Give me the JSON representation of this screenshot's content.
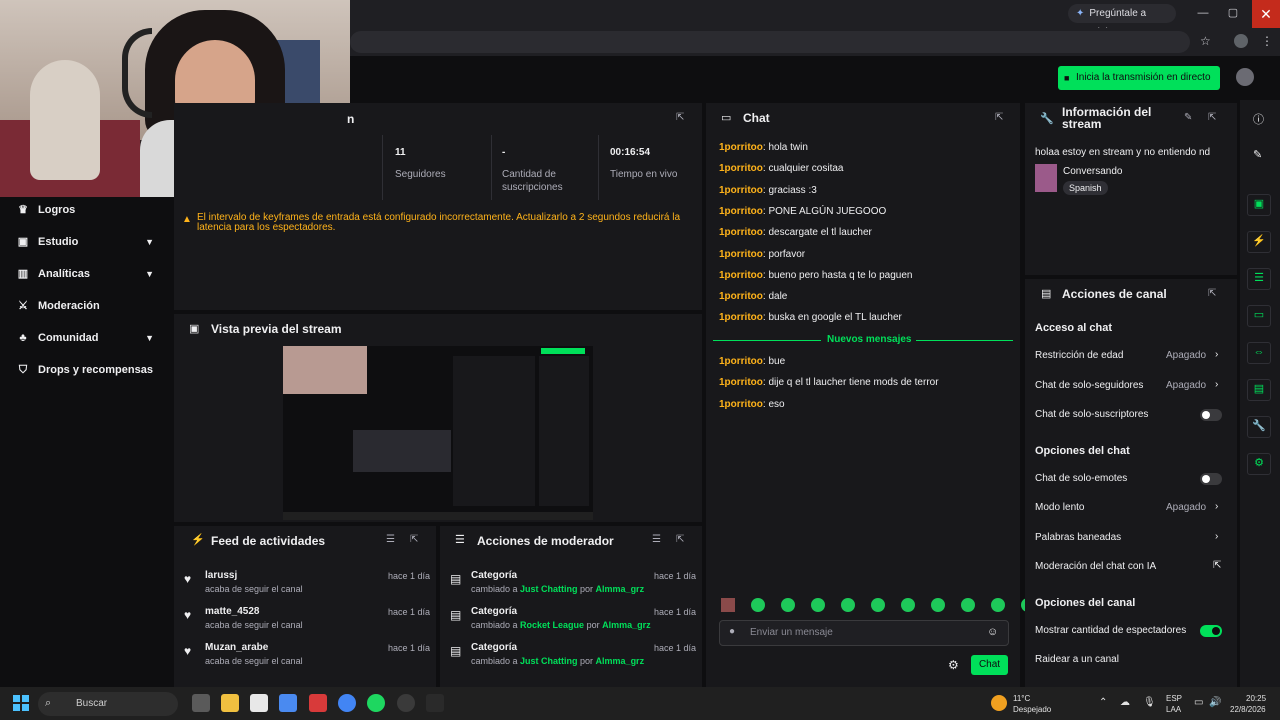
{
  "browser": {
    "gemini_label": "Pregúntale a Gemini",
    "minimize": "—",
    "maximize": "▢",
    "close": "✕"
  },
  "topbar": {
    "go_live": "Inicia la transmisión en directo"
  },
  "sidebar": {
    "items": [
      {
        "label": "Logros",
        "icon": "trophy-icon",
        "expandable": false
      },
      {
        "label": "Estudio",
        "icon": "camera-icon",
        "expandable": true
      },
      {
        "label": "Analíticas",
        "icon": "analytics-icon",
        "expandable": true
      },
      {
        "label": "Moderación",
        "icon": "sword-icon",
        "expandable": false
      },
      {
        "label": "Comunidad",
        "icon": "people-icon",
        "expandable": true
      },
      {
        "label": "Drops y recompensas",
        "icon": "gift-icon",
        "expandable": false
      }
    ]
  },
  "session": {
    "title_partial": "n",
    "stats": [
      {
        "value": "11",
        "label": "Seguidores"
      },
      {
        "value": "-",
        "label": "Cantidad de suscripciones"
      },
      {
        "value": "00:16:54",
        "label": "Tiempo en vivo"
      }
    ],
    "warning": "El intervalo de keyframes de entrada está configurado incorrectamente. Actualizarlo a 2 segundos reducirá la latencia para los espectadores."
  },
  "preview": {
    "title": "Vista previa del stream"
  },
  "feed": {
    "title": "Feed de actividades",
    "items": [
      {
        "name": "larussj",
        "sub": "acaba de seguir el canal",
        "time": "hace 1 día"
      },
      {
        "name": "matte_4528",
        "sub": "acaba de seguir el canal",
        "time": "hace 1 día"
      },
      {
        "name": "Muzan_arabe",
        "sub": "acaba de seguir el canal",
        "time": "hace 1 día"
      }
    ]
  },
  "modactions": {
    "title": "Acciones de moderador",
    "items": [
      {
        "title": "Categoría",
        "pre": "cambiado a ",
        "category": "Just Chatting",
        "mid": " por ",
        "user": "Almma_grz",
        "time": "hace 1 día"
      },
      {
        "title": "Categoría",
        "pre": "cambiado a ",
        "category": "Rocket League",
        "mid": " por ",
        "user": "Almma_grz",
        "time": "hace 1 día"
      },
      {
        "title": "Categoría",
        "pre": "cambiado a ",
        "category": "Just Chatting",
        "mid": " por ",
        "user": "Almma_grz",
        "time": "hace 1 día"
      }
    ]
  },
  "chat": {
    "title": "Chat",
    "messages": [
      {
        "user": "1porritoo",
        "text": ": hola twin"
      },
      {
        "user": "1porritoo",
        "text": ": cualquier cositaa"
      },
      {
        "user": "1porritoo",
        "text": ": graciass :3"
      },
      {
        "user": "1porritoo",
        "text": ": PONE ALGÚN JUEGOOO"
      },
      {
        "user": "1porritoo",
        "text": ": descargate el tl laucher"
      },
      {
        "user": "1porritoo",
        "text": ": porfavor"
      },
      {
        "user": "1porritoo",
        "text": ": bueno pero hasta q te lo paguen"
      },
      {
        "user": "1porritoo",
        "text": ": dale"
      },
      {
        "user": "1porritoo",
        "text": ": buska en google el TL laucher"
      }
    ],
    "new_label": "Nuevos mensajes",
    "new_messages": [
      {
        "user": "1porritoo",
        "text": ": bue"
      },
      {
        "user": "1porritoo",
        "text": ": dije q el tl laucher tiene mods de terror"
      },
      {
        "user": "1porritoo",
        "text": ": eso"
      }
    ],
    "placeholder": "Enviar un mensaje",
    "send_label": "Chat"
  },
  "info": {
    "title": "Información del stream",
    "stream_title": "holaa estoy en stream y no entiendo nd",
    "category": "Conversando",
    "tag": "Spanish"
  },
  "channel_actions": {
    "title": "Acciones de canal",
    "sections": [
      {
        "heading": "Acceso al chat",
        "rows": [
          {
            "label": "Restricción de edad",
            "value": "Apagado",
            "kind": "chevron"
          },
          {
            "label": "Chat de solo-seguidores",
            "value": "Apagado",
            "kind": "chevron"
          },
          {
            "label": "Chat de solo-suscriptores",
            "value": "",
            "kind": "toggle-off"
          }
        ]
      },
      {
        "heading": "Opciones del chat",
        "rows": [
          {
            "label": "Chat de solo-emotes",
            "value": "",
            "kind": "toggle-off"
          },
          {
            "label": "Modo lento",
            "value": "Apagado",
            "kind": "chevron"
          },
          {
            "label": "Palabras baneadas",
            "value": "",
            "kind": "chevron"
          },
          {
            "label": "Moderación del chat con IA",
            "value": "",
            "kind": "external"
          }
        ]
      },
      {
        "heading": "Opciones del canal",
        "rows": [
          {
            "label": "Mostrar cantidad de espectadores",
            "value": "",
            "kind": "toggle-on"
          },
          {
            "label": "Raidear a un canal",
            "value": "",
            "kind": "none"
          }
        ]
      }
    ]
  },
  "taskbar": {
    "search": "Buscar",
    "weather_temp": "11°C",
    "weather_desc": "Despejado",
    "lang1": "ESP",
    "lang2": "LAA",
    "time": "20:25",
    "date": "22/8/2026"
  },
  "colors": {
    "accent": "#00e05a",
    "username": "#ffb31a",
    "panel": "#18181b",
    "bg": "#0e0e10"
  }
}
